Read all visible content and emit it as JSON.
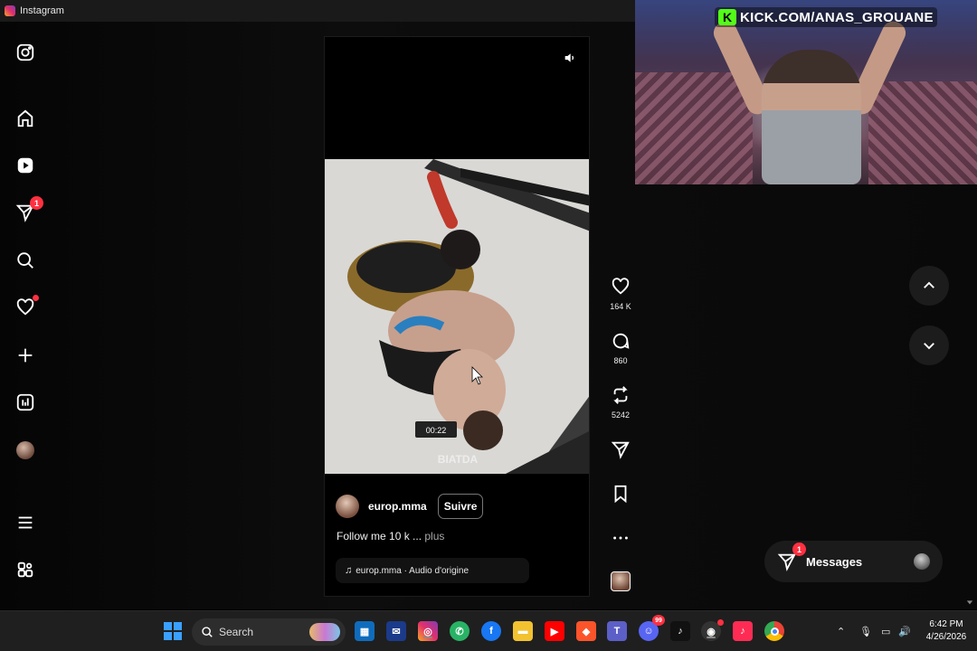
{
  "window": {
    "title": "Instagram"
  },
  "nav": {
    "notifications_badge": "1"
  },
  "reel": {
    "username": "europ.mma",
    "follow_label": "Suivre",
    "caption": "Follow me 10 k ...",
    "caption_more": "plus",
    "audio": "europ.mma · Audio d'origine",
    "video_timer": "00:22",
    "video_watermark": "BIATDA"
  },
  "actions": {
    "likes": "164 K",
    "comments": "860",
    "reposts": "5242"
  },
  "overlay": {
    "stream_url": "KICK.COM/ANAS_GROUANE",
    "kick_letter": "K"
  },
  "messages": {
    "label": "Messages",
    "badge": "1"
  },
  "taskbar": {
    "search_label": "Search",
    "time": "6:42 PM",
    "date": "4/26/2026",
    "discord_badge": "99"
  },
  "colors": {
    "badge": "#ff3040",
    "kick_green": "#53fc18",
    "background": "#0b0b0b"
  }
}
